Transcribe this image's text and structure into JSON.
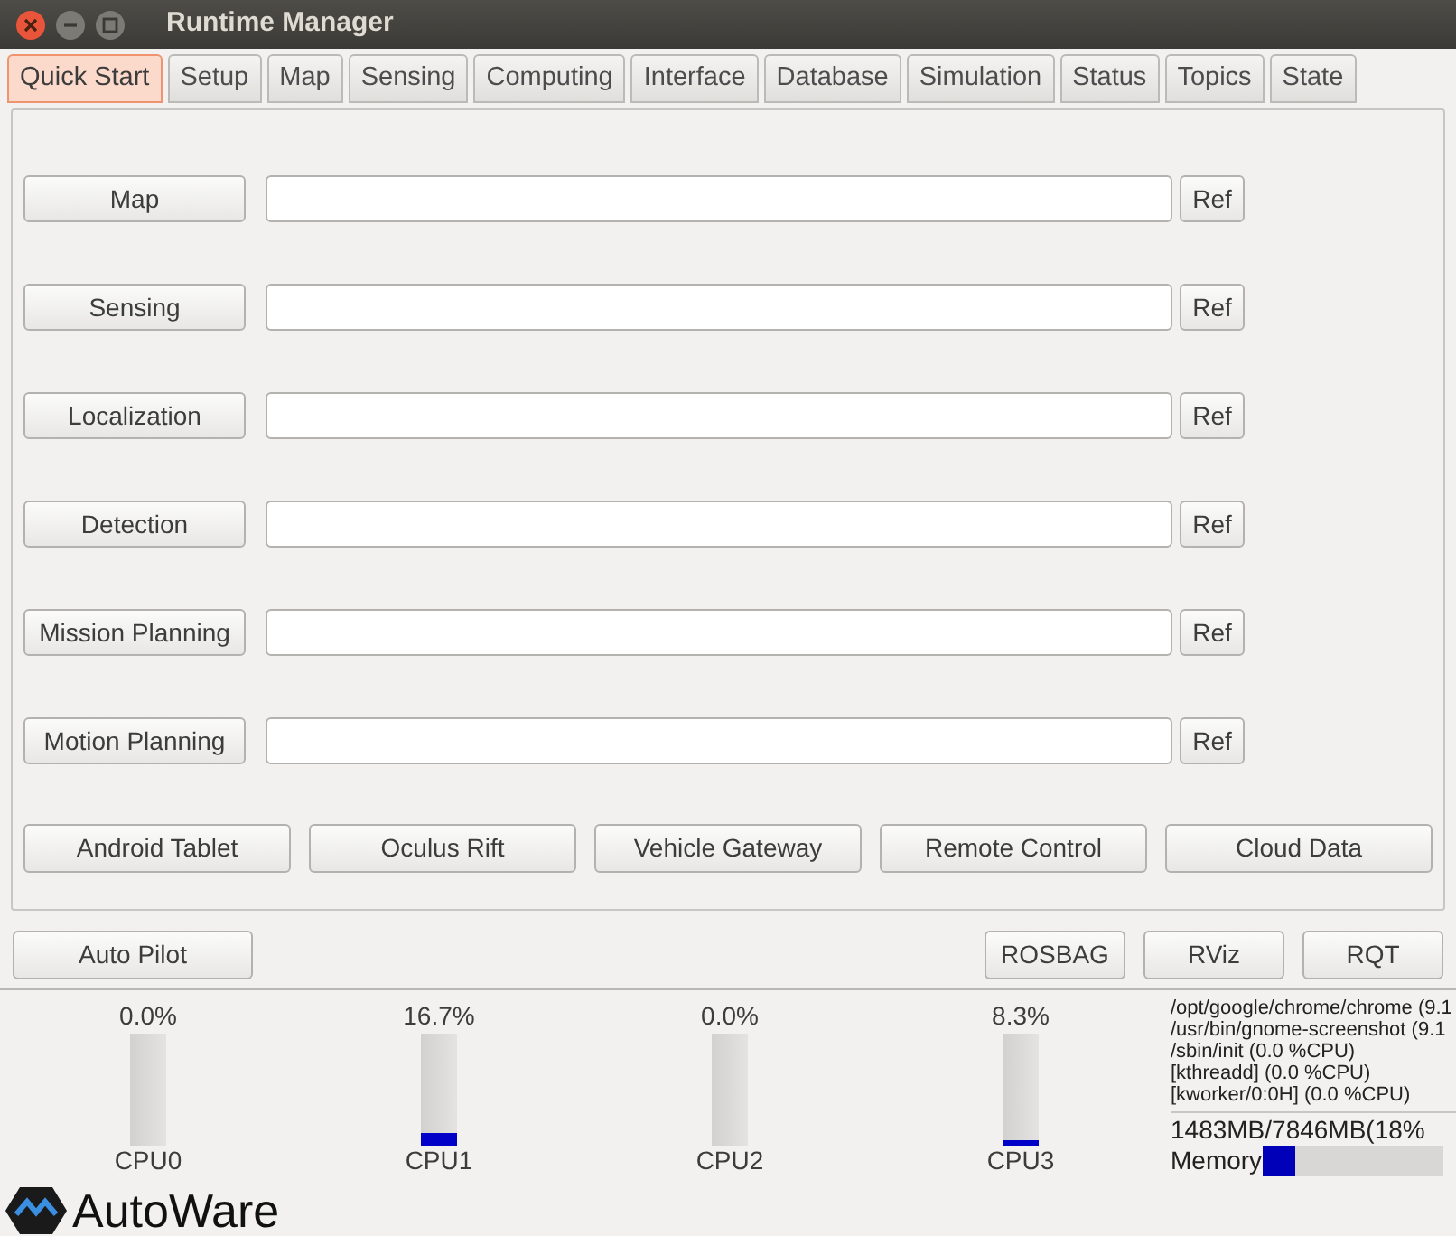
{
  "window": {
    "title": "Runtime Manager"
  },
  "tabs": [
    {
      "label": "Quick Start",
      "selected": true
    },
    {
      "label": "Setup",
      "selected": false
    },
    {
      "label": "Map",
      "selected": false
    },
    {
      "label": "Sensing",
      "selected": false
    },
    {
      "label": "Computing",
      "selected": false
    },
    {
      "label": "Interface",
      "selected": false
    },
    {
      "label": "Database",
      "selected": false
    },
    {
      "label": "Simulation",
      "selected": false
    },
    {
      "label": "Status",
      "selected": false
    },
    {
      "label": "Topics",
      "selected": false
    },
    {
      "label": "State",
      "selected": false
    }
  ],
  "launch_rows": [
    {
      "button": "Map",
      "ref": "Ref"
    },
    {
      "button": "Sensing",
      "ref": "Ref"
    },
    {
      "button": "Localization",
      "ref": "Ref"
    },
    {
      "button": "Detection",
      "ref": "Ref"
    },
    {
      "button": "Mission Planning",
      "ref": "Ref"
    },
    {
      "button": "Motion Planning",
      "ref": "Ref"
    }
  ],
  "device_buttons": [
    "Android Tablet",
    "Oculus Rift",
    "Vehicle Gateway",
    "Remote Control",
    "Cloud Data"
  ],
  "bottom_left_buttons": [
    "Auto Pilot"
  ],
  "bottom_right_buttons": [
    "ROSBAG",
    "RViz",
    "RQT"
  ],
  "cpus": [
    {
      "reading": "0.0%",
      "label": "CPU0",
      "level": 0
    },
    {
      "reading": "16.7%",
      "label": "CPU1",
      "level": 0.12
    },
    {
      "reading": "0.0%",
      "label": "CPU2",
      "level": 0
    },
    {
      "reading": "8.3%",
      "label": "CPU3",
      "level": 0.05
    }
  ],
  "processes": [
    "/opt/google/chrome/chrome (9.1",
    "/usr/bin/gnome-screenshot (9.1",
    "/sbin/init (0.0 %CPU)",
    "[kthreadd] (0.0 %CPU)",
    "[kworker/0:0H] (0.0 %CPU)"
  ],
  "memory": {
    "reading": "1483MB/7846MB(18%",
    "label": "Memory",
    "level": 0.18
  },
  "logo": {
    "text": "AutoWare"
  }
}
